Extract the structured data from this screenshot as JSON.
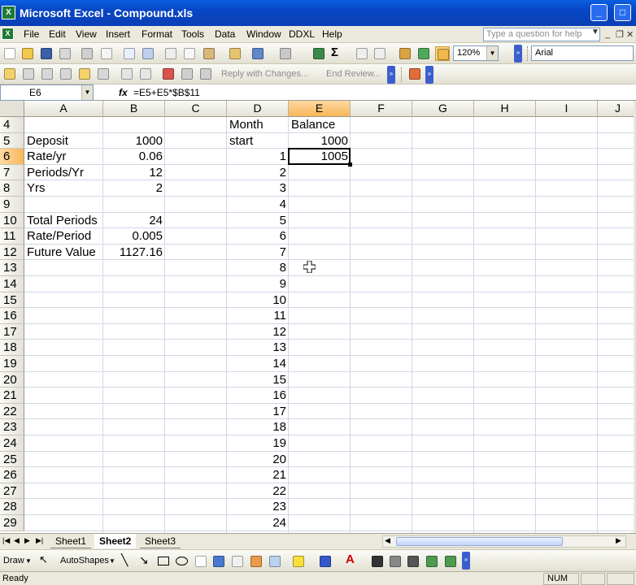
{
  "window": {
    "title": "Microsoft Excel - Compound.xls",
    "app_icon": "excel-icon"
  },
  "menu": [
    "File",
    "Edit",
    "View",
    "Insert",
    "Format",
    "Tools",
    "Data",
    "Window",
    "DDXL",
    "Help"
  ],
  "help_box": {
    "placeholder": "Type a question for help"
  },
  "toolbar": {
    "zoom": "120%",
    "font": "Arial"
  },
  "review_toolbar": {
    "reply": "Reply with Changes...",
    "end_review": "End Review..."
  },
  "formula_bar": {
    "name_box": "E6",
    "fx_label": "fx",
    "formula": "=E5+E5*$B$11"
  },
  "columns": [
    "A",
    "B",
    "C",
    "D",
    "E",
    "F",
    "G",
    "H",
    "I",
    "J"
  ],
  "rows": [
    "4",
    "5",
    "6",
    "7",
    "8",
    "9",
    "10",
    "11",
    "12",
    "13",
    "14",
    "15",
    "16",
    "17",
    "18",
    "19",
    "20",
    "21",
    "22",
    "23",
    "24",
    "25",
    "26",
    "27",
    "28",
    "29"
  ],
  "selected_cell": {
    "column": "E",
    "row": "6"
  },
  "cells": {
    "A5": "Deposit",
    "B5": "1000",
    "A6": "Rate/yr",
    "B6": "0.06",
    "A7": "Periods/Yr",
    "B7": "12",
    "A8": "Yrs",
    "B8": "2",
    "A10": "Total Periods",
    "B10": "24",
    "A11": "Rate/Period",
    "B11": "0.005",
    "A12": "Future Value",
    "B12": "1127.16",
    "D4": "Month",
    "E4": "Balance",
    "D5": "start",
    "E5": "1000",
    "E6": "1005",
    "D6": "1",
    "D7": "2",
    "D8": "3",
    "D9": "4",
    "D10": "5",
    "D11": "6",
    "D12": "7",
    "D13": "8",
    "D14": "9",
    "D15": "10",
    "D16": "11",
    "D17": "12",
    "D18": "13",
    "D19": "14",
    "D20": "15",
    "D21": "16",
    "D22": "17",
    "D23": "18",
    "D24": "19",
    "D25": "20",
    "D26": "21",
    "D27": "22",
    "D28": "23",
    "D29": "24"
  },
  "sheets": [
    "Sheet1",
    "Sheet2",
    "Sheet3"
  ],
  "active_sheet": "Sheet2",
  "draw_toolbar": {
    "draw": "Draw",
    "autoshapes": "AutoShapes"
  },
  "status": {
    "left": "Ready",
    "num": "NUM"
  }
}
